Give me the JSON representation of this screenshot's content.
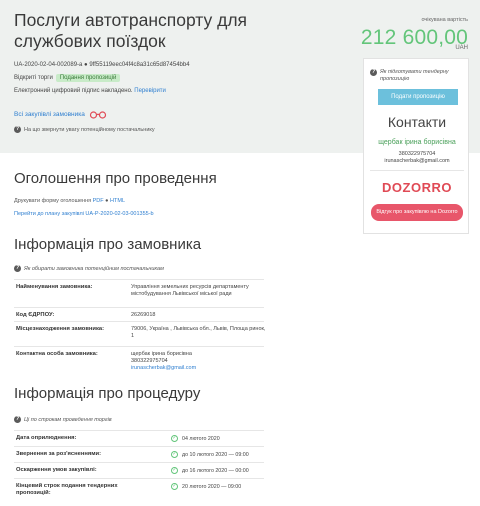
{
  "header": {
    "title": "Послуги автотранспорту для службових поїздок",
    "tender_id": "UA-2020-02-04-002089-a ● 9ff55119eec04f4c8a31c65d87454bb4",
    "status_label": "Відкриті торги",
    "status_badge": "Подання пропозицій",
    "signature_text": "Електронний цифровий підпис накладено.",
    "signature_link": "Перевірити",
    "favorites_label": "Всі закупівлі замовника",
    "attention_text": "На що звернути увагу потенційному постачальнику"
  },
  "value": {
    "label": "очікувана вартість",
    "amount": "212 600,00",
    "currency": "UAH"
  },
  "sidebar": {
    "note": "Як підготувати тендерну пропозицію",
    "submit_button": "Подати пропозицію",
    "contacts_title": "Контакти",
    "contact_name": "щербак ірина борисівна",
    "contact_phone": "380322975704",
    "contact_email": "irunascherbak@gmail.com",
    "dozorro_logo": "DOZORRO",
    "dozorro_button": "Відгук про закупівлю на Dozorro"
  },
  "announcement": {
    "title": "Оголошення про проведення",
    "print_label": "Друкувати форму оголошення",
    "print_pdf": "PDF",
    "print_sep": "●",
    "print_html": "HTML",
    "plan_link": "Перейти до плану закупівлі UA-P-2020-02-03-001355-b"
  },
  "customer": {
    "title": "Інформація про замовника",
    "note": "Як обирати замовника потенційним постачальникам",
    "rows": [
      {
        "key": "Найменування замовника:",
        "value": "Управління земельних ресурсів департаменту містобудування Львівської міської ради"
      },
      {
        "key": "Код ЄДРПОУ:",
        "value": "26269018"
      },
      {
        "key": "Місцезнаходження замовника:",
        "value": "79006, Україна , Львівська обл., Львів, Площа ринок, 1"
      },
      {
        "key": "Контактна особа замовника:",
        "value_name": "щербак ірина борисівна",
        "value_phone": "380322975704",
        "value_email": "irunascherbak@gmail.com"
      }
    ]
  },
  "procedure": {
    "title": "Інформація про процедуру",
    "note": "Ці по строкам проведення торгів",
    "rows": [
      {
        "key": "Дата оприлюднення:",
        "value": "04 лютого 2020"
      },
      {
        "key": "Звернення за роз'ясненнями:",
        "value": "до 10 лютого 2020 — 09:00"
      },
      {
        "key": "Оскарження умов закупівлі:",
        "value": "до 16 лютого 2020 — 00:00"
      },
      {
        "key": "Кінцевий строк подання тендерних пропозицій:",
        "value": "20 лютого 2020 — 09:00"
      }
    ]
  },
  "colors": {
    "accent_green": "#63c57a",
    "link_blue": "#2f7fd0",
    "button_blue": "#6cc0dc",
    "dozorro_red": "#e04a55"
  }
}
